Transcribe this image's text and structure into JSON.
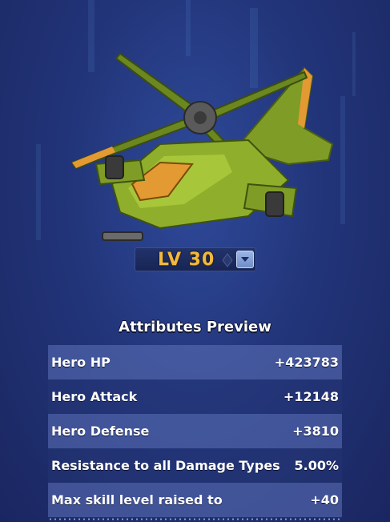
{
  "level": {
    "label": "LV 30"
  },
  "attributes": {
    "title": "Attributes Preview",
    "rows": [
      {
        "name": "Hero HP",
        "value": "+423783"
      },
      {
        "name": "Hero Attack",
        "value": "+12148"
      },
      {
        "name": "Hero Defense",
        "value": "+3810"
      },
      {
        "name": "Resistance to all Damage Types",
        "value": "5.00%"
      },
      {
        "name": "Max skill level raised to",
        "value": "+40"
      }
    ]
  },
  "colors": {
    "background": "#22357a",
    "level_text": "#f2b93b",
    "row_highlight": "#5f73b9",
    "heli_body": "#8fae2c",
    "heli_accent": "#f1a43a"
  },
  "icons": {
    "hero_image": "attack-helicopter",
    "dropdown": "chevron-down-icon"
  }
}
